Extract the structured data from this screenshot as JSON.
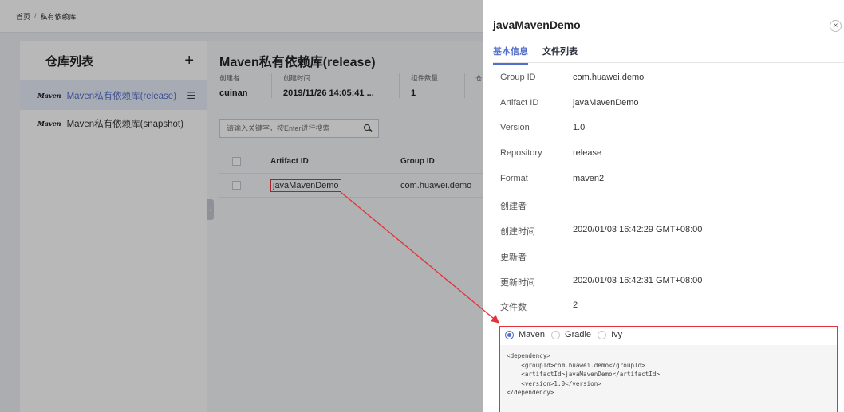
{
  "breadcrumb": {
    "home": "首页",
    "separator": "/",
    "current": "私有依赖库"
  },
  "sidebar": {
    "title": "仓库列表",
    "add_icon": "plus-icon",
    "items": [
      {
        "logo": "Maven",
        "label": "Maven私有依赖库(release)",
        "active": true
      },
      {
        "logo": "Maven",
        "label": "Maven私有依赖库(snapshot)",
        "active": false
      }
    ]
  },
  "main": {
    "title": "Maven私有依赖库(release)",
    "meta": [
      {
        "label": "创建者",
        "value": "cuinan"
      },
      {
        "label": "创建时间",
        "value": "2019/11/26 14:05:41 ..."
      },
      {
        "label": "组件数量",
        "value": "1"
      },
      {
        "label": "仓",
        "value": ""
      }
    ],
    "search_placeholder": "请输入关键字，按Enter进行搜索",
    "table": {
      "headers": [
        "Artifact ID",
        "Group ID"
      ],
      "rows": [
        {
          "artifact_id": "javaMavenDemo",
          "group_id": "com.huawei.demo"
        }
      ]
    }
  },
  "drawer": {
    "title": "javaMavenDemo",
    "close": "×",
    "tabs": [
      "基本信息",
      "文件列表"
    ],
    "info": [
      {
        "label": "Group ID",
        "value": "com.huawei.demo"
      },
      {
        "label": "Artifact ID",
        "value": "javaMavenDemo"
      },
      {
        "label": "Version",
        "value": "1.0"
      },
      {
        "label": "Repository",
        "value": "release"
      },
      {
        "label": "Format",
        "value": "maven2"
      },
      {
        "label": "创建者",
        "value": ""
      },
      {
        "label": "创建时间",
        "value": "2020/01/03 16:42:29 GMT+08:00"
      },
      {
        "label": "更新者",
        "value": ""
      },
      {
        "label": "更新时间",
        "value": "2020/01/03 16:42:31 GMT+08:00"
      },
      {
        "label": "文件数",
        "value": "2"
      }
    ],
    "build_tools": [
      "Maven",
      "Gradle",
      "Ivy"
    ],
    "selected_tool": "Maven",
    "dependency_snippet": "<dependency>\n    <groupId>com.huawei.demo</groupId>\n    <artifactId>javaMavenDemo</artifactId>\n    <version>1.0</version>\n</dependency>"
  },
  "colors": {
    "accent": "#526ecc",
    "highlight": "#e5323b"
  }
}
